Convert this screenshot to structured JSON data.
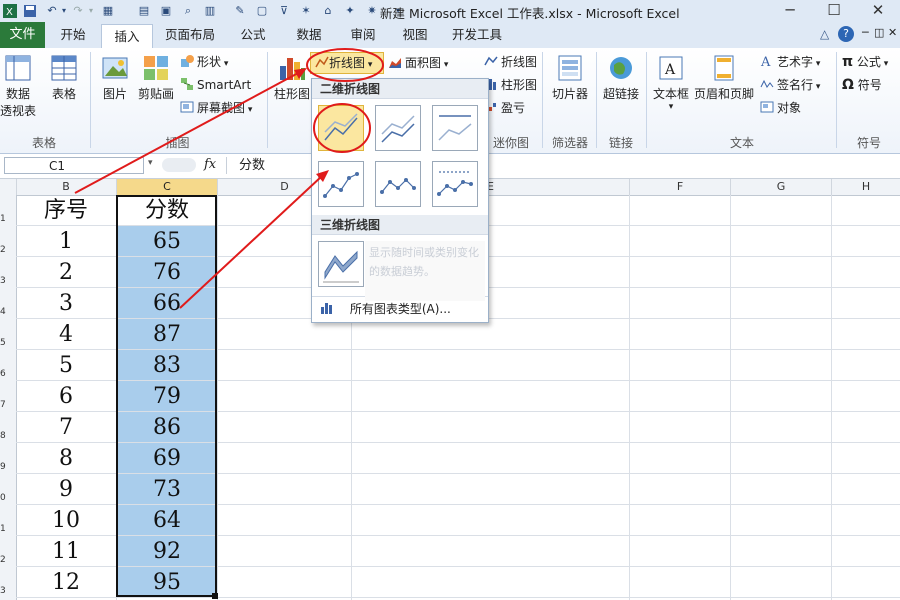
{
  "window": {
    "title": "新建 Microsoft Excel 工作表.xlsx - Microsoft Excel",
    "controls": {
      "minimize": "─",
      "maximize": "☐",
      "close": "✕"
    },
    "help": "?"
  },
  "tabs": {
    "file": "文件",
    "items": [
      "开始",
      "插入",
      "页面布局",
      "公式",
      "数据",
      "审阅",
      "视图",
      "开发工具"
    ],
    "active": "插入"
  },
  "ribbon": {
    "tables": {
      "label": "表格",
      "pivot_line1": "数据",
      "pivot_line2": "透视表",
      "table": "表格"
    },
    "illustrations": {
      "label": "插图",
      "picture": "图片",
      "clipart": "剪贴画",
      "shapes": "形状",
      "smartart": "SmartArt",
      "screenshot": "屏幕截图"
    },
    "charts": {
      "column": "柱形图",
      "line": "折线图",
      "area": "面积图"
    },
    "sparklines": {
      "label": "迷你图",
      "line": "折线图",
      "column": "柱形图",
      "winloss": "盈亏"
    },
    "filter": {
      "label": "筛选器",
      "slicer": "切片器"
    },
    "links": {
      "label": "链接",
      "hyperlink": "超链接"
    },
    "text": {
      "label": "文本",
      "textbox": "文本框",
      "header_footer": "页眉和页脚",
      "wordart": "艺术字",
      "signature": "签名行",
      "object": "对象"
    },
    "symbols": {
      "label": "符号",
      "equation": "公式",
      "symbol": "符号",
      "pi": "π",
      "omega": "Ω"
    }
  },
  "formula_bar": {
    "cell": "C1",
    "fx": "fx",
    "content": "分数"
  },
  "columns": [
    "B",
    "C",
    "D",
    "E",
    "F",
    "G",
    "H"
  ],
  "row_numbers": [
    "1",
    "2",
    "3",
    "4",
    "5",
    "6",
    "7",
    "8",
    "9",
    "0",
    "1",
    "2",
    "3"
  ],
  "table": {
    "headers": [
      "序号",
      "分数"
    ],
    "rows": [
      [
        "1",
        "65"
      ],
      [
        "2",
        "76"
      ],
      [
        "3",
        "66"
      ],
      [
        "4",
        "87"
      ],
      [
        "5",
        "83"
      ],
      [
        "6",
        "79"
      ],
      [
        "7",
        "86"
      ],
      [
        "8",
        "69"
      ],
      [
        "9",
        "73"
      ],
      [
        "10",
        "64"
      ],
      [
        "11",
        "92"
      ],
      [
        "12",
        "95"
      ]
    ]
  },
  "line_dropdown": {
    "section_2d": "二维折线图",
    "section_3d": "三维折线图",
    "all_types": "所有图表类型(A)...",
    "tooltip_ghost": "显示随时间或类别变化的数据趋势。"
  },
  "colors": {
    "file_tab": "#2b7a3a",
    "selection": "#a9cdec",
    "annotation": "#e01b1b",
    "highlight": "#fbe7a0"
  }
}
